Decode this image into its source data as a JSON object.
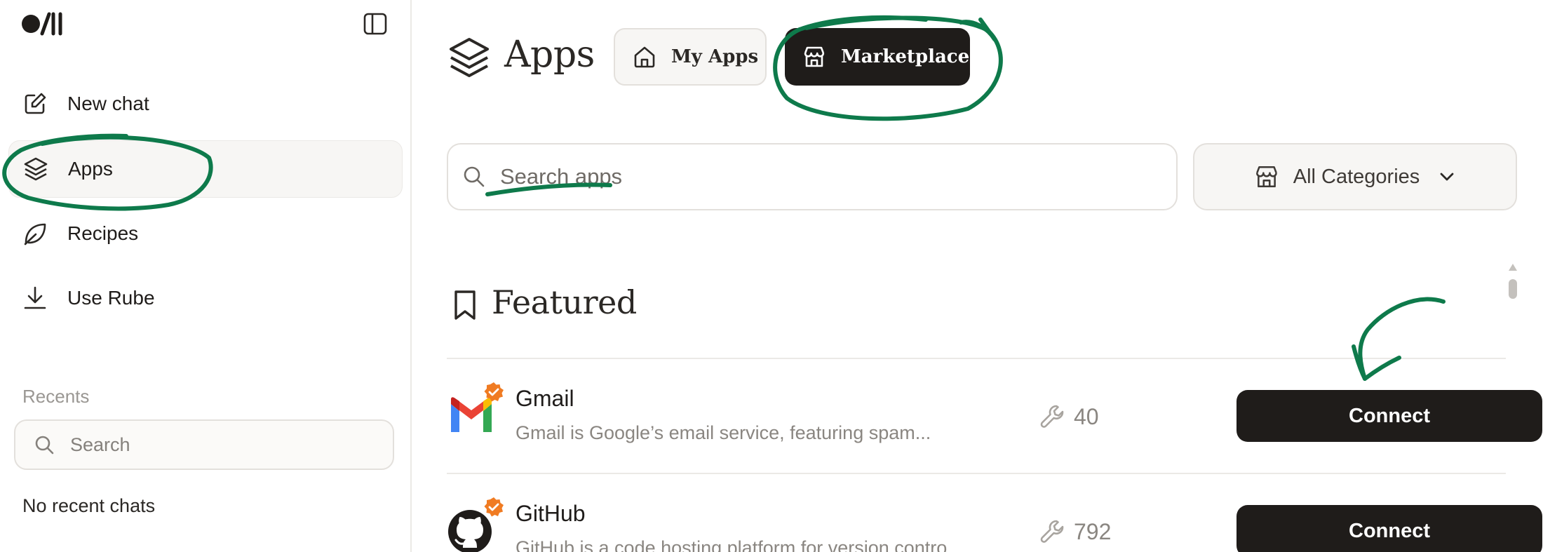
{
  "colors": {
    "dark": "#1f1c1a",
    "annotation_green": "#0e7a4b",
    "verified_orange": "#f07b22",
    "muted_text": "#8a8681",
    "border": "#e3e0dc"
  },
  "sidebar": {
    "logo_icon": "brand-logo-icon",
    "toggle_icon": "sidebar-toggle-icon",
    "nav": [
      {
        "label": "New chat",
        "icon": "edit-icon"
      },
      {
        "label": "Apps",
        "icon": "layers-icon",
        "active": true
      },
      {
        "label": "Recipes",
        "icon": "leaf-icon"
      },
      {
        "label": "Use Rube",
        "icon": "download-icon"
      }
    ],
    "recents_label": "Recents",
    "search_placeholder": "Search",
    "empty_text": "No recent chats"
  },
  "main": {
    "title": "Apps",
    "tabs": [
      {
        "label": "My Apps",
        "icon": "home-icon"
      },
      {
        "label": "Marketplace",
        "icon": "store-icon",
        "selected": true
      }
    ],
    "search_placeholder": "Search apps",
    "category_select": {
      "value": "All Categories",
      "icon": "store-icon"
    },
    "featured": {
      "title": "Featured",
      "icon": "bookmark-icon",
      "apps": [
        {
          "name": "Gmail",
          "description": "Gmail is Google’s email service, featuring spam...",
          "tools": "40",
          "button": "Connect",
          "logo": "gmail-logo",
          "verified": true
        },
        {
          "name": "GitHub",
          "description": "GitHub is a code hosting platform for version contro...",
          "tools": "792",
          "button": "Connect",
          "logo": "github-logo",
          "verified": true
        }
      ]
    }
  }
}
